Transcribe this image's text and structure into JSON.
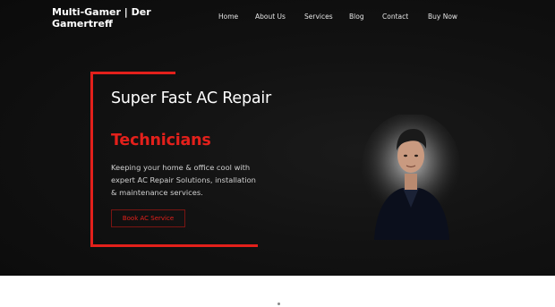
{
  "header": {
    "brand": "Multi-Gamer | Der Gamertreff"
  },
  "nav": {
    "items": [
      "Home",
      "About Us",
      "Services",
      "Blog",
      "Contact",
      "Buy Now"
    ]
  },
  "hero": {
    "headline": "Super Fast AC Repair",
    "headline_accent": "Technicians",
    "description": "Keeping your home & office cool with expert AC Repair Solutions, installation & maintenance services.",
    "cta_label": "Book AC Service"
  },
  "colors": {
    "accent": "#e3201b",
    "background": "#121212",
    "text": "#ffffff"
  }
}
